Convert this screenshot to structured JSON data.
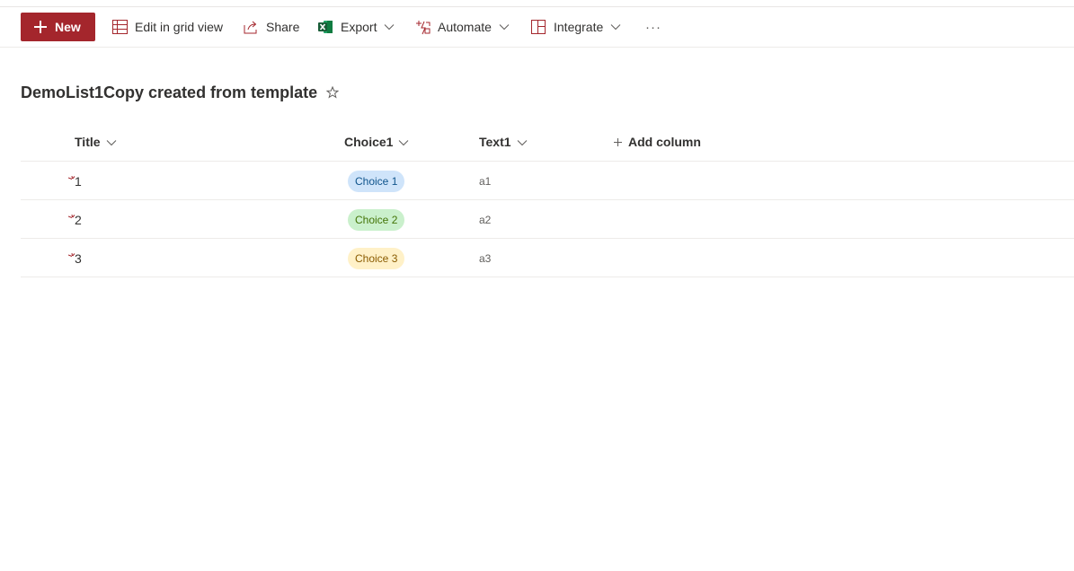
{
  "toolbar": {
    "new_label": "New",
    "edit_grid_label": "Edit in grid view",
    "share_label": "Share",
    "export_label": "Export",
    "automate_label": "Automate",
    "integrate_label": "Integrate",
    "more_label": "···"
  },
  "list": {
    "title": "DemoList1Copy created from template",
    "columns": {
      "title": "Title",
      "choice1": "Choice1",
      "text1": "Text1",
      "add_column": "Add column"
    },
    "rows": [
      {
        "title": "1",
        "choice": "Choice 1",
        "text": "a1"
      },
      {
        "title": "2",
        "choice": "Choice 2",
        "text": "a2"
      },
      {
        "title": "3",
        "choice": "Choice 3",
        "text": "a3"
      }
    ]
  },
  "colors": {
    "accent": "#a4262c",
    "choice1_bg": "#cfe4fa",
    "choice1_fg": "#0f548c",
    "choice2_bg": "#caf0cc",
    "choice2_fg": "#437406",
    "choice3_bg": "#fff1c8",
    "choice3_fg": "#8a5b00"
  }
}
